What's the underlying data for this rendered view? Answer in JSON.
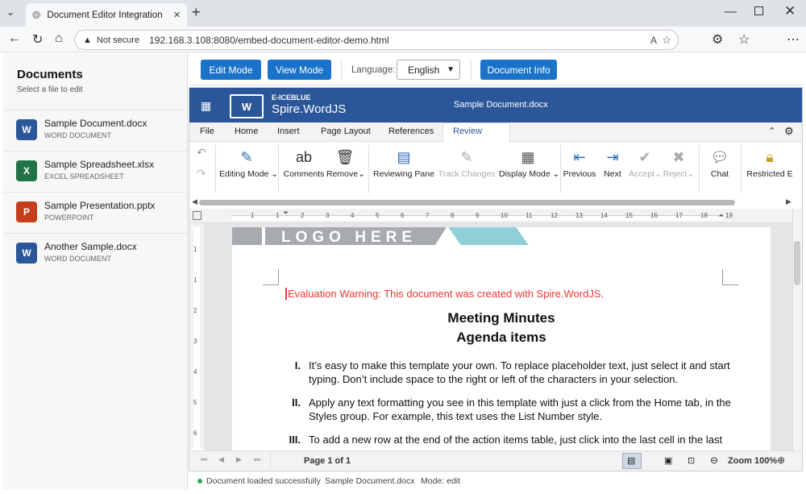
{
  "browser": {
    "tab_title": "Document Editor Integration Demo",
    "not_secure": "Not secure",
    "url": "192.168.3.108:8080/embed-document-editor-demo.html"
  },
  "sidebar": {
    "title": "Documents",
    "subtitle": "Select a file to edit",
    "files": [
      {
        "name": "Sample Document.docx",
        "type": "WORD DOCUMENT",
        "icon": "W",
        "color": "#2b579a"
      },
      {
        "name": "Sample Spreadsheet.xlsx",
        "type": "EXCEL SPREADSHEET",
        "icon": "X",
        "color": "#217346"
      },
      {
        "name": "Sample Presentation.pptx",
        "type": "POWERPOINT",
        "icon": "P",
        "color": "#c43e1c"
      },
      {
        "name": "Another Sample.docx",
        "type": "WORD DOCUMENT",
        "icon": "W",
        "color": "#2b579a"
      }
    ]
  },
  "toolbar": {
    "edit_mode": "Edit Mode",
    "view_mode": "View Mode",
    "language_label": "Language:",
    "language_value": "English",
    "doc_info": "Document Info"
  },
  "editor": {
    "brand_top": "E-ICEBLUE",
    "brand_name": "Spire.WordJS",
    "doc_title": "Sample Document.docx",
    "tabs": [
      "File",
      "Home",
      "Insert",
      "Page Layout",
      "References",
      "Review"
    ],
    "active_tab": "Review",
    "ribbon": {
      "editing_mode": "Editing Mode",
      "comments": "Comments",
      "remove": "Remove",
      "reviewing_pane": "Reviewing Pane",
      "track_changes": "Track Changes",
      "display_mode": "Display Mode",
      "previous": "Previous",
      "next": "Next",
      "accept": "Accept",
      "reject": "Reject",
      "chat": "Chat",
      "restricted": "Restricted E"
    },
    "ruler_numbers": [
      "1",
      "1",
      "2",
      "3",
      "4",
      "5",
      "6",
      "7",
      "8",
      "9",
      "10",
      "11",
      "12",
      "13",
      "14",
      "15",
      "16",
      "17",
      "18",
      "19"
    ],
    "vruler_numbers": [
      "1",
      "1",
      "2",
      "3",
      "4",
      "5",
      "6"
    ],
    "document": {
      "logo": "LOGO HERE",
      "warning": "Evaluation Warning: This document was created with Spire.WordJS.",
      "heading1": "Meeting Minutes",
      "heading2": "Agenda items",
      "items": [
        {
          "num": "I.",
          "text": "It’s easy to make this template your own. To replace placeholder text, just select it and start typing. Don’t include space to the right or left of the characters in your selection."
        },
        {
          "num": "II.",
          "text": "Apply any text formatting you see in this template with just a click from the Home tab, in the Styles group. For example, this text uses the List Number style."
        },
        {
          "num": "III.",
          "text": "To add a new row at the end of the action items table, just click into the last cell in the last"
        }
      ]
    },
    "status": {
      "page": "Page 1 of 1",
      "zoom": "Zoom 100%"
    }
  },
  "footer": {
    "status": "Document loaded successfully",
    "file": "Sample Document.docx",
    "mode": "Mode: edit"
  }
}
